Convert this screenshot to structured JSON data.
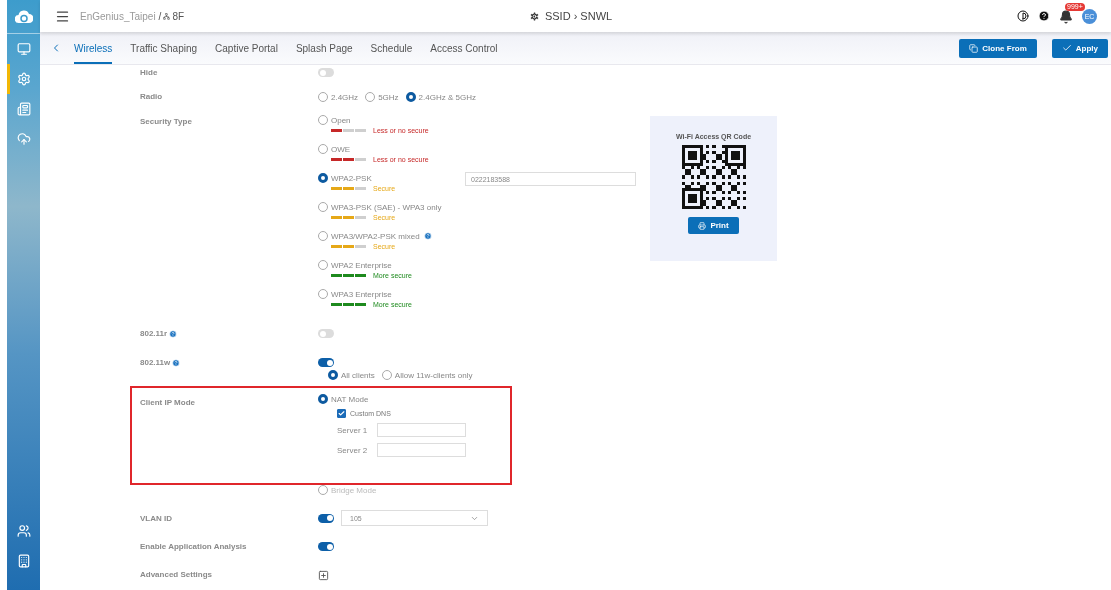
{
  "header": {
    "org": "EnGenius_Taipei",
    "separator": "/",
    "floor": "8F",
    "title": "SSID › SNWL",
    "badge": "999+",
    "avatar": "EC"
  },
  "sidebar": {
    "items": [
      {
        "selected": false
      },
      {
        "selected": true
      },
      {
        "selected": false
      },
      {
        "selected": false
      }
    ],
    "bottom_items": [
      {
        "selected": false
      },
      {
        "selected": false
      }
    ]
  },
  "tabs": [
    {
      "label": "Wireless",
      "selected": true
    },
    {
      "label": "Traffic Shaping",
      "selected": false
    },
    {
      "label": "Captive Portal",
      "selected": false
    },
    {
      "label": "Splash Page",
      "selected": false
    },
    {
      "label": "Schedule",
      "selected": false
    },
    {
      "label": "Access Control",
      "selected": false
    }
  ],
  "buttons": [
    {
      "label": "Clone From"
    },
    {
      "label": "Apply"
    }
  ],
  "form": {
    "hide": {
      "label": "Hide",
      "on": false
    },
    "radio": {
      "label": "Radio",
      "options": [
        {
          "label": "2.4GHz",
          "selected": false
        },
        {
          "label": "5GHz",
          "selected": false
        },
        {
          "label": "2.4GHz & 5GHz",
          "selected": true
        }
      ]
    },
    "security": {
      "label": "Security Type",
      "options": [
        {
          "label": "Open",
          "selected": false,
          "help": false,
          "level": 0.33,
          "color": "#c62828",
          "strength": "Less or no secure"
        },
        {
          "label": "OWE",
          "selected": false,
          "help": false,
          "level": 0.67,
          "color": "#c62828",
          "strength": "Less or no secure"
        },
        {
          "label": "WPA2-PSK",
          "selected": true,
          "help": false,
          "level": 0.67,
          "color": "#e6a817",
          "strength": "Secure"
        },
        {
          "label": "WPA3-PSK (SAE) - WPA3 only",
          "selected": false,
          "help": false,
          "level": 0.67,
          "color": "#e6a817",
          "strength": "Secure"
        },
        {
          "label": "WPA3/WPA2-PSK mixed",
          "selected": false,
          "help": true,
          "level": 0.67,
          "color": "#e6a817",
          "strength": "Secure"
        },
        {
          "label": "WPA2 Enterprise",
          "selected": false,
          "help": false,
          "level": 1,
          "color": "#1e8a1e",
          "strength": "More secure"
        },
        {
          "label": "WPA3 Enterprise",
          "selected": false,
          "help": false,
          "level": 1,
          "color": "#1e8a1e",
          "strength": "More secure"
        }
      ],
      "password": "0222183588",
      "qr": {
        "title": "Wi-Fi Access QR Code",
        "print": "Print"
      }
    },
    "fast_roaming": {
      "label": "802.11r",
      "help": true,
      "on": false
    },
    "pmf": {
      "label": "802.11w",
      "help": true,
      "on": true,
      "options": [
        {
          "label": "All clients",
          "selected": true
        },
        {
          "label": "Allow 11w-clients only",
          "selected": false
        }
      ]
    },
    "client_ip": {
      "label": "Client IP Mode",
      "highlighted": true,
      "modes": [
        {
          "label": "NAT Mode",
          "selected": true
        },
        {
          "label": "Bridge Mode",
          "selected": false
        }
      ],
      "custom_dns": {
        "label": "Custom DNS",
        "checked": true
      },
      "servers": [
        {
          "label": "Server 1"
        },
        {
          "label": "Server 2"
        }
      ]
    },
    "vlan": {
      "label": "VLAN ID",
      "on": true,
      "value": "105"
    },
    "app_analysis": {
      "label": "Enable Application Analysis",
      "on": true
    },
    "advanced": {
      "label": "Advanced Settings"
    }
  }
}
